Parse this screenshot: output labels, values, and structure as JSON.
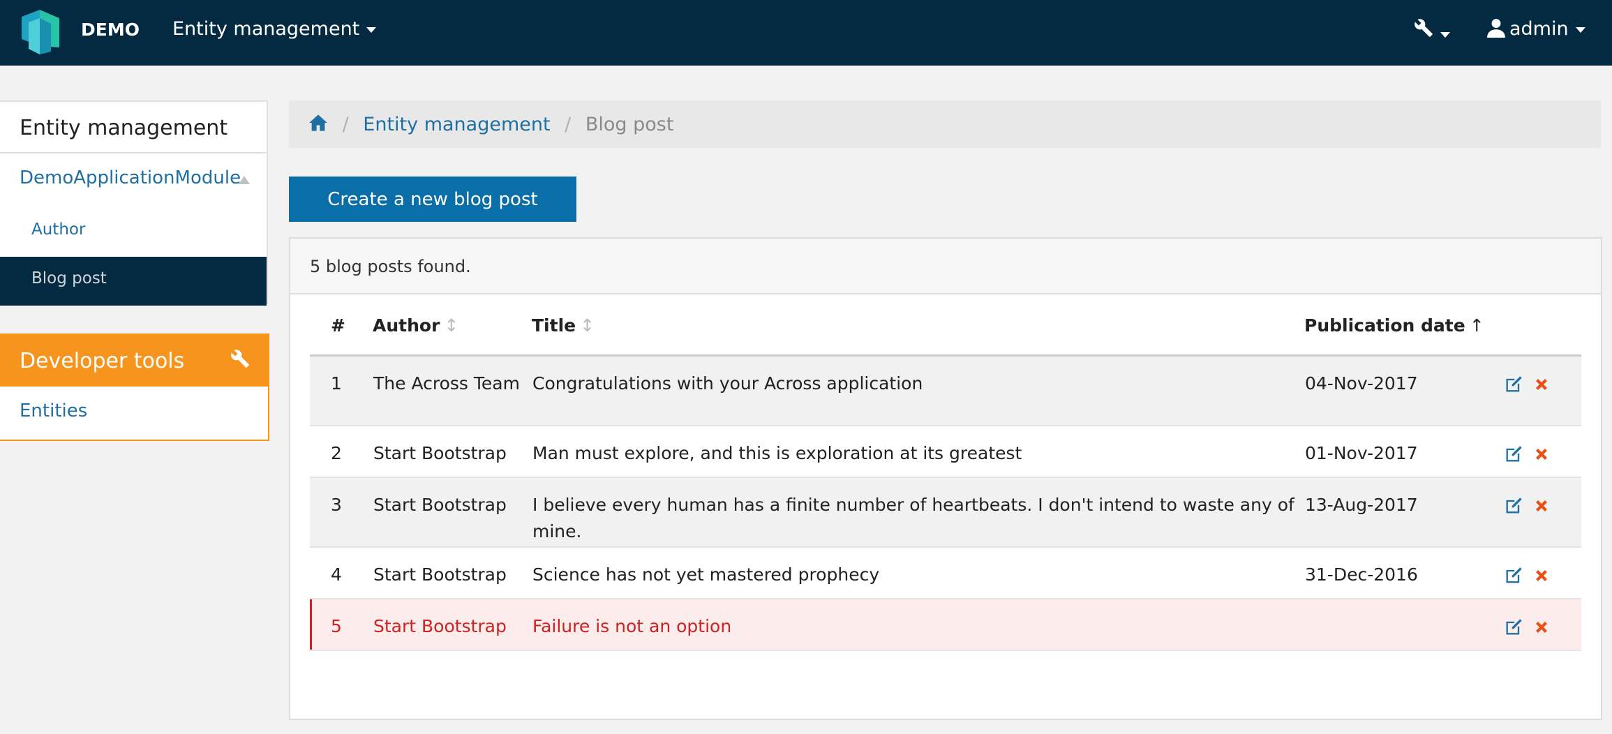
{
  "navbar": {
    "brand": "DEMO",
    "menu_label": "Entity management",
    "user_label": "admin",
    "bg_color": "#032a40"
  },
  "sidebar": {
    "entity_panel_title": "Entity management",
    "module_label": "DemoApplicationModule",
    "items": [
      {
        "label": "Author",
        "active": false
      },
      {
        "label": "Blog post",
        "active": true
      }
    ],
    "dev_panel_title": "Developer tools",
    "dev_link": "Entities",
    "dev_color": "#f7941d"
  },
  "breadcrumb": {
    "items": [
      "Entity management",
      "Blog post"
    ]
  },
  "main": {
    "create_button": "Create a new blog post",
    "results_summary": "5 blog posts found.",
    "table": {
      "headers": {
        "num": "#",
        "author": "Author",
        "title": "Title",
        "date": "Publication date",
        "sort_unsorted_glyph": "↕",
        "sort_asc_glyph": "↑"
      },
      "rows": [
        {
          "num": "1",
          "author": "The Across Team",
          "title": "Congratulations with your Across application",
          "date": "04-Nov-2017"
        },
        {
          "num": "2",
          "author": "Start Bootstrap",
          "title": "Man must explore, and this is exploration at its greatest",
          "date": "01-Nov-2017"
        },
        {
          "num": "3",
          "author": "Start Bootstrap",
          "title": "I believe every human has a finite number of heartbeats. I don't intend to waste any of mine.",
          "date": "13-Aug-2017"
        },
        {
          "num": "4",
          "author": "Start Bootstrap",
          "title": "Science has not yet mastered prophecy",
          "date": "31-Dec-2016"
        },
        {
          "num": "5",
          "author": "Start Bootstrap",
          "title": "Failure is not an option",
          "date": ""
        }
      ]
    }
  },
  "icons": {
    "logo": "app-logo",
    "wrench": "wrench-icon",
    "user": "user-icon",
    "home": "home-icon",
    "edit": "edit-icon",
    "delete": "delete-icon"
  },
  "colors": {
    "link": "#1f6fa3",
    "primary_button": "#0a6fa8",
    "danger_text": "#cc2222",
    "danger_row_bg": "#fdecec"
  }
}
